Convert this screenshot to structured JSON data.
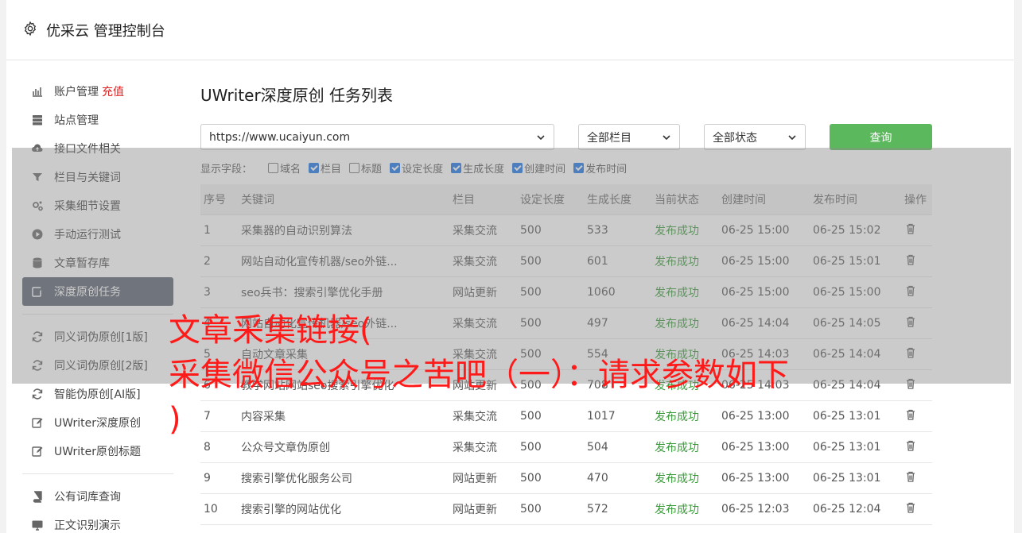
{
  "header": {
    "title": "优采云 管理控制台",
    "icon": "gear-icon"
  },
  "sidebar": {
    "items": [
      {
        "label": "账户管理",
        "extra": "充值",
        "icon": "bar-chart-icon"
      },
      {
        "label": "站点管理",
        "icon": "server-icon"
      },
      {
        "label": "接口文件相关",
        "icon": "cloud-upload-icon"
      },
      {
        "label": "栏目与关键词",
        "icon": "filter-icon"
      },
      {
        "label": "采集细节设置",
        "icon": "gears-icon"
      },
      {
        "label": "手动运行测试",
        "icon": "play-icon"
      },
      {
        "label": "文章暂存库",
        "icon": "database-icon"
      },
      {
        "label": "深度原创任务",
        "icon": "edit-icon",
        "active": true
      },
      {
        "label": "同义词伪原创[1版]",
        "icon": "refresh-icon"
      },
      {
        "label": "同义词伪原创[2版]",
        "icon": "refresh-icon"
      },
      {
        "label": "智能伪原创[AI版]",
        "icon": "refresh-icon"
      },
      {
        "label": "UWriter深度原创",
        "icon": "edit-icon"
      },
      {
        "label": "UWriter原创标题",
        "icon": "edit-icon"
      },
      {
        "label": "公有词库查询",
        "icon": "book-icon"
      },
      {
        "label": "正文识别演示",
        "icon": "monitor-icon"
      }
    ]
  },
  "main": {
    "title": "UWriter深度原创 任务列表",
    "site_select": "https://www.ucaiyun.com",
    "column_select": "全部栏目",
    "status_select": "全部状态",
    "query_button": "查询",
    "fields_label": "显示字段：",
    "fields": [
      {
        "label": "域名",
        "checked": false
      },
      {
        "label": "栏目",
        "checked": true
      },
      {
        "label": "标题",
        "checked": false
      },
      {
        "label": "设定长度",
        "checked": true
      },
      {
        "label": "生成长度",
        "checked": true
      },
      {
        "label": "创建时间",
        "checked": true
      },
      {
        "label": "发布时间",
        "checked": true
      }
    ],
    "columns": [
      "序号",
      "关键词",
      "栏目",
      "设定长度",
      "生成长度",
      "当前状态",
      "创建时间",
      "发布时间",
      "操作"
    ],
    "rows": [
      [
        "1",
        "采集器的自动识别算法",
        "采集交流",
        "500",
        "533",
        "发布成功",
        "06-25 15:00",
        "06-25 15:02"
      ],
      [
        "2",
        "网站自动化宣传机器/seo外链...",
        "采集交流",
        "500",
        "601",
        "发布成功",
        "06-25 15:00",
        "06-25 15:01"
      ],
      [
        "3",
        "seo兵书：搜索引擎优化手册",
        "网站更新",
        "500",
        "1060",
        "发布成功",
        "06-25 15:00",
        "06-25 15:00"
      ],
      [
        "4",
        "网站自动化宣传机器/seo外链...",
        "采集交流",
        "500",
        "497",
        "发布成功",
        "06-25 14:04",
        "06-25 14:05"
      ],
      [
        "5",
        "自动文章采集",
        "采集交流",
        "500",
        "554",
        "发布成功",
        "06-25 14:03",
        "06-25 14:04"
      ],
      [
        "6",
        "教学网站网站seo搜索引擎优化",
        "网站更新",
        "500",
        "708",
        "发布成功",
        "06-25 14:03",
        "06-25 14:04"
      ],
      [
        "7",
        "内容采集",
        "采集交流",
        "500",
        "1017",
        "发布成功",
        "06-25 13:00",
        "06-25 13:01"
      ],
      [
        "8",
        "公众号文章伪原创",
        "采集交流",
        "500",
        "504",
        "发布成功",
        "06-25 13:00",
        "06-25 13:01"
      ],
      [
        "9",
        "搜索引擎优化服务公司",
        "网站更新",
        "500",
        "470",
        "发布成功",
        "06-25 13:00",
        "06-25 13:01"
      ],
      [
        "10",
        "搜索引擎的网站优化",
        "网站更新",
        "500",
        "572",
        "发布成功",
        "06-25 12:03",
        "06-25 12:04"
      ]
    ]
  },
  "watermark": {
    "line1": "文章采集链接(",
    "line2": "采集微信公众号之苦吧（一）：请求参数如下",
    "line3": ")"
  },
  "colors": {
    "active_nav": "#5a6170",
    "query_button": "#5cb85c",
    "success": "#3a9a3a",
    "watermark": "#ff1a1a",
    "recharge": "#e02020"
  }
}
